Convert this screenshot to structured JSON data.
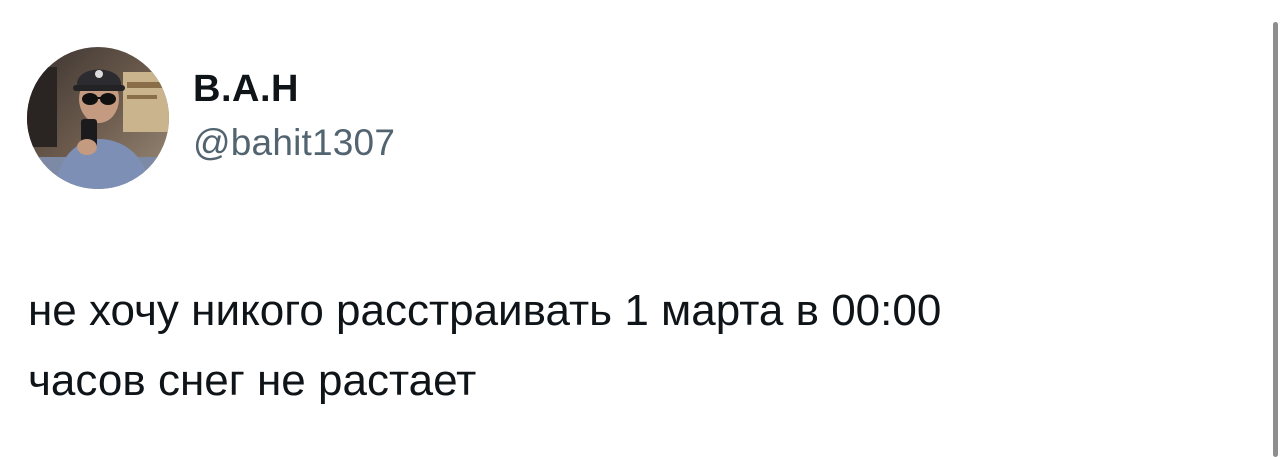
{
  "tweet": {
    "author": {
      "display_name": "В.А.Н",
      "handle": "@bahit1307",
      "avatar": "user-avatar-photo"
    },
    "text_lines": [
      "не хочу никого расстраивать 1 марта в 00:00",
      "часов снег не растает"
    ]
  },
  "colors": {
    "text_primary": "#0f1419",
    "text_secondary": "#536471",
    "background": "#ffffff",
    "scrollbar": "#8e8e8e"
  }
}
